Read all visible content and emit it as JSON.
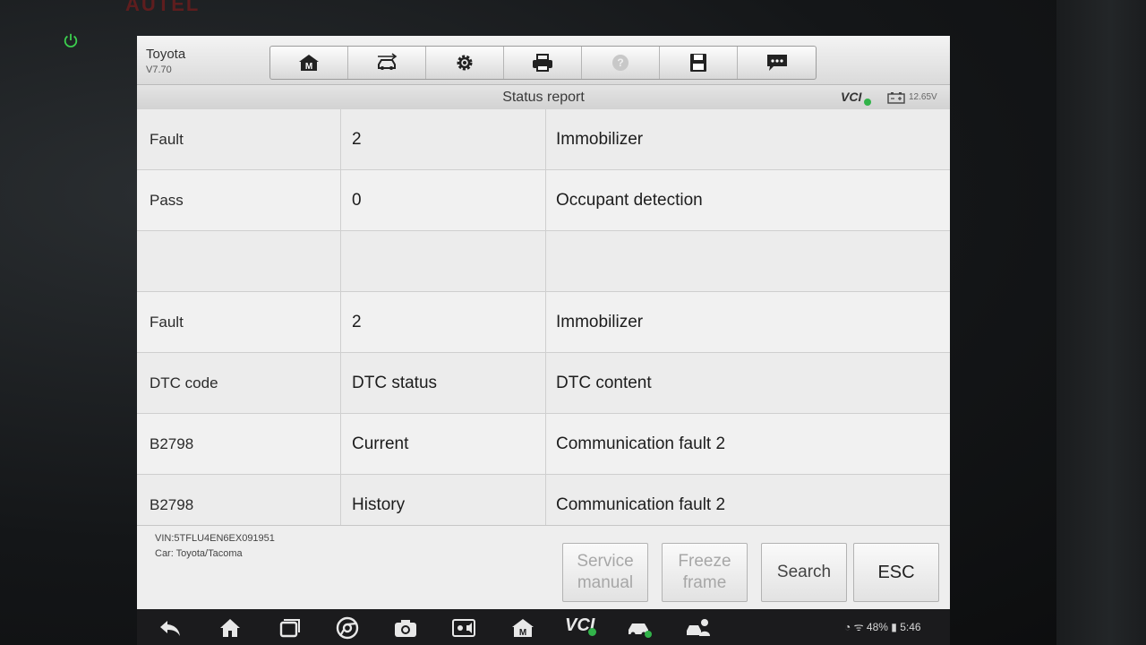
{
  "device": {
    "brand": "AUTEL"
  },
  "header": {
    "app_name": "Toyota",
    "app_version": "V7.70",
    "toolbar": [
      "home-icon",
      "vehicle-swap-icon",
      "settings-icon",
      "print-icon",
      "help-icon",
      "save-icon",
      "message-icon"
    ]
  },
  "titlebar": {
    "title": "Status report",
    "vci_label": "VCI",
    "voltage": "12.65V"
  },
  "table": {
    "rows": [
      {
        "c1": "Fault",
        "c2": "2",
        "c3": "Immobilizer"
      },
      {
        "c1": "Pass",
        "c2": "0",
        "c3": "Occupant detection"
      },
      {
        "c1": "",
        "c2": "",
        "c3": ""
      },
      {
        "c1": "Fault",
        "c2": "2",
        "c3": "Immobilizer"
      },
      {
        "c1": "DTC code",
        "c2": "DTC status",
        "c3": "DTC content"
      },
      {
        "c1": "B2798",
        "c2": "Current",
        "c3": "Communication fault 2"
      },
      {
        "c1": "B2798",
        "c2": "History",
        "c3": "Communication fault 2"
      }
    ]
  },
  "footer": {
    "vin": "VIN:5TFLU4EN6EX091951",
    "car": "Car: Toyota/Tacoma",
    "buttons": {
      "service_manual_1": "Service",
      "service_manual_2": "manual",
      "freeze_frame_1": "Freeze",
      "freeze_frame_2": "frame",
      "search": "Search",
      "esc": "ESC"
    }
  },
  "navbar": {
    "vci_label": "VCI",
    "status": "48%",
    "time": "5:46"
  },
  "colors": {
    "vci_green": "#32b34a",
    "power_green": "#3ccf4e"
  }
}
